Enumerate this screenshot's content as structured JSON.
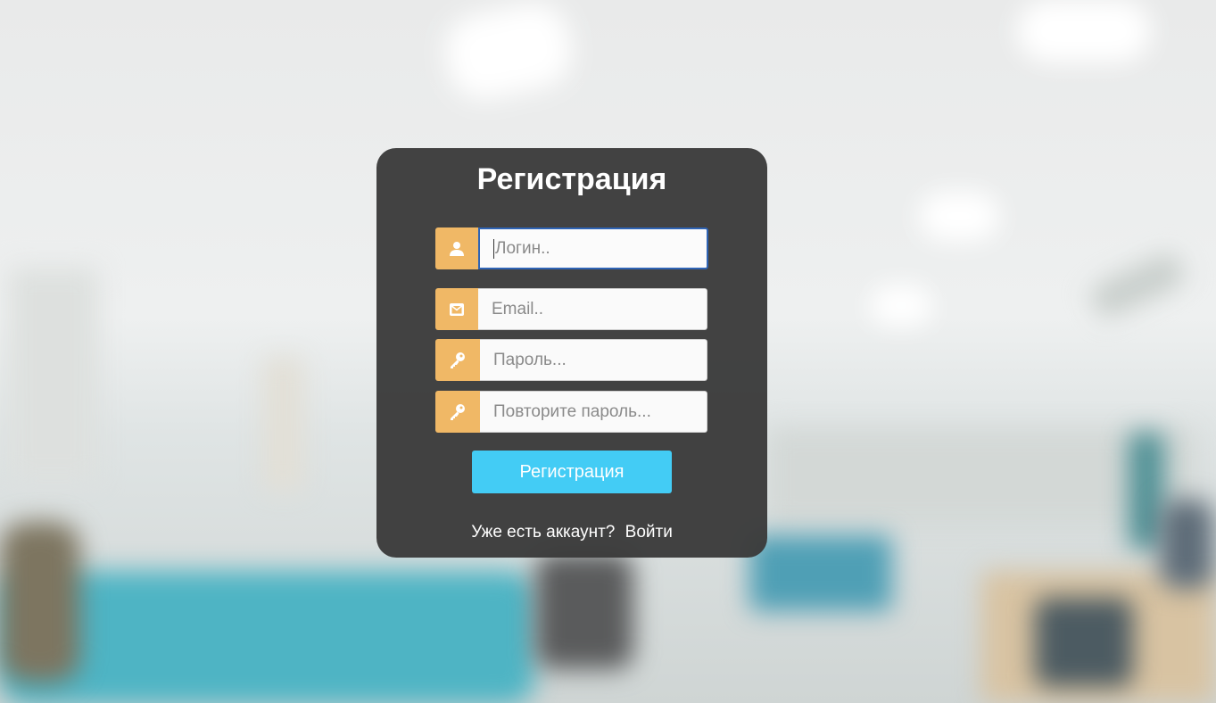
{
  "page": {
    "title": "Регистрация"
  },
  "form": {
    "login": {
      "placeholder": "Логин..",
      "icon": "user-icon"
    },
    "email": {
      "placeholder": "Email..",
      "icon": "envelope-icon"
    },
    "password": {
      "placeholder": "Пароль...",
      "icon": "key-icon"
    },
    "password_repeat": {
      "placeholder": "Повторите пароль...",
      "icon": "key-icon"
    },
    "submit_label": "Регистрация"
  },
  "footer": {
    "prompt": "Уже есть аккаунт?",
    "login_link": "Войти"
  },
  "colors": {
    "panel": "#3a3a3a",
    "addon": "#f0b866",
    "button": "#43ccf5",
    "focus_border": "#2f64b5"
  }
}
